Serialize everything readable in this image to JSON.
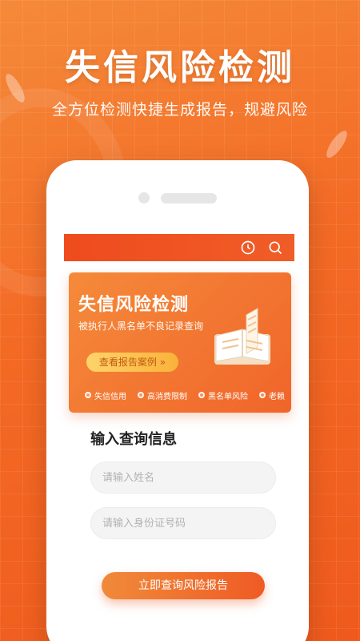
{
  "hero": {
    "title": "失信风险检测",
    "subtitle": "全方位检测快捷生成报告，规避风险"
  },
  "appbar": {
    "icons": [
      "history-icon",
      "search-icon"
    ]
  },
  "banner": {
    "title": "失信风险检测",
    "subtitle": "被执行人黑名单不良记录查询",
    "button_label": "查看报告案例 »",
    "tags": [
      "失信信用",
      "高消费限制",
      "黑名单风险",
      "老赖"
    ]
  },
  "form": {
    "title": "输入查询信息",
    "name_placeholder": "请输入姓名",
    "id_placeholder": "请输入身份证号码",
    "submit_label": "立即查询风险报告"
  },
  "colors": {
    "accent": "#ef5b24",
    "accent_light": "#f58a3a",
    "button_yellow": "#f9b23a"
  }
}
